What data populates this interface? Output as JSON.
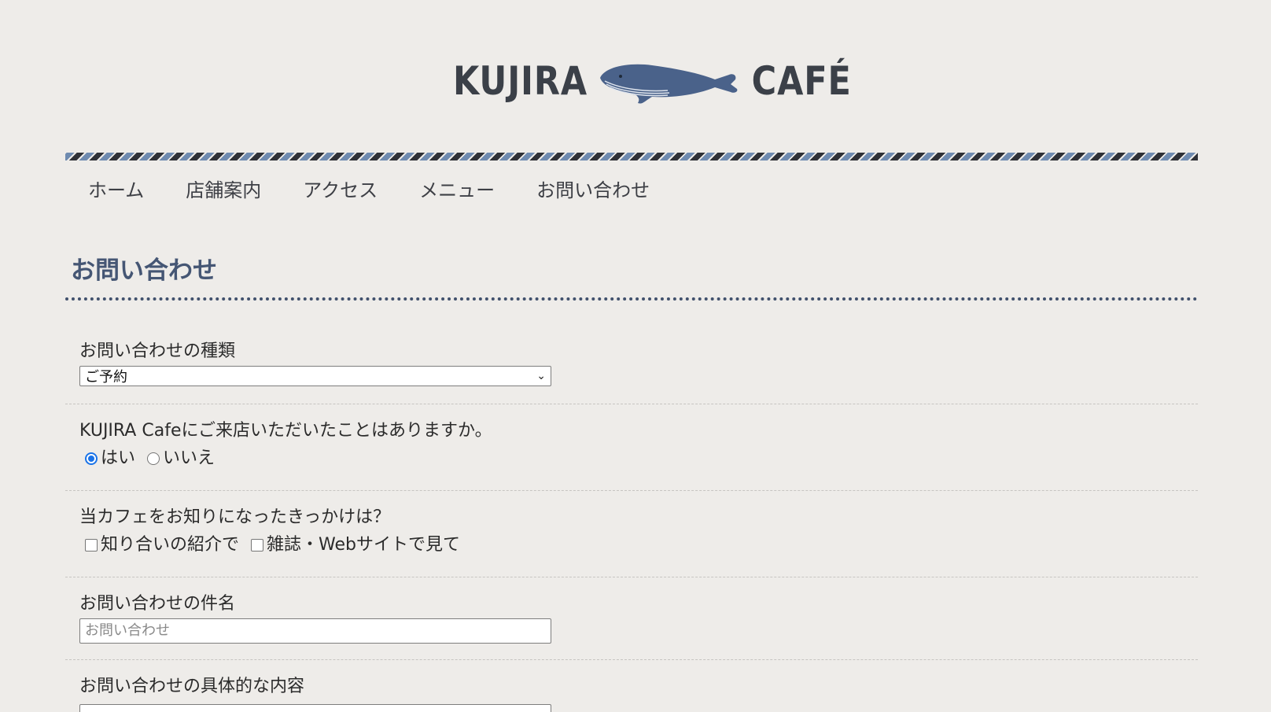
{
  "logo": {
    "left_word": "KUJIRA",
    "right_word": "CAFÉ",
    "whale_icon": "whale-icon",
    "color_text": "#3b4048",
    "color_whale": "#4a628a"
  },
  "nav": {
    "items": [
      {
        "label": "ホーム"
      },
      {
        "label": "店舗案内"
      },
      {
        "label": "アクセス"
      },
      {
        "label": "メニュー"
      },
      {
        "label": "お問い合わせ"
      }
    ]
  },
  "page": {
    "title": "お問い合わせ",
    "title_color": "#455674"
  },
  "form": {
    "type_label": "お問い合わせの種類",
    "type_selected": "ご予約",
    "visited_label": "KUJIRA Cafeにご来店いただいたことはありますか。",
    "visited_options": [
      {
        "label": "はい",
        "checked": true
      },
      {
        "label": "いいえ",
        "checked": false
      }
    ],
    "source_label": "当カフェをお知りになったきっかけは？",
    "source_options": [
      {
        "label": "知り合いの紹介で",
        "checked": false
      },
      {
        "label": "雑誌・Webサイトで見て",
        "checked": false
      }
    ],
    "subject_label": "お問い合わせの件名",
    "subject_placeholder": "お問い合わせ",
    "detail_label": "お問い合わせの具体的な内容"
  }
}
